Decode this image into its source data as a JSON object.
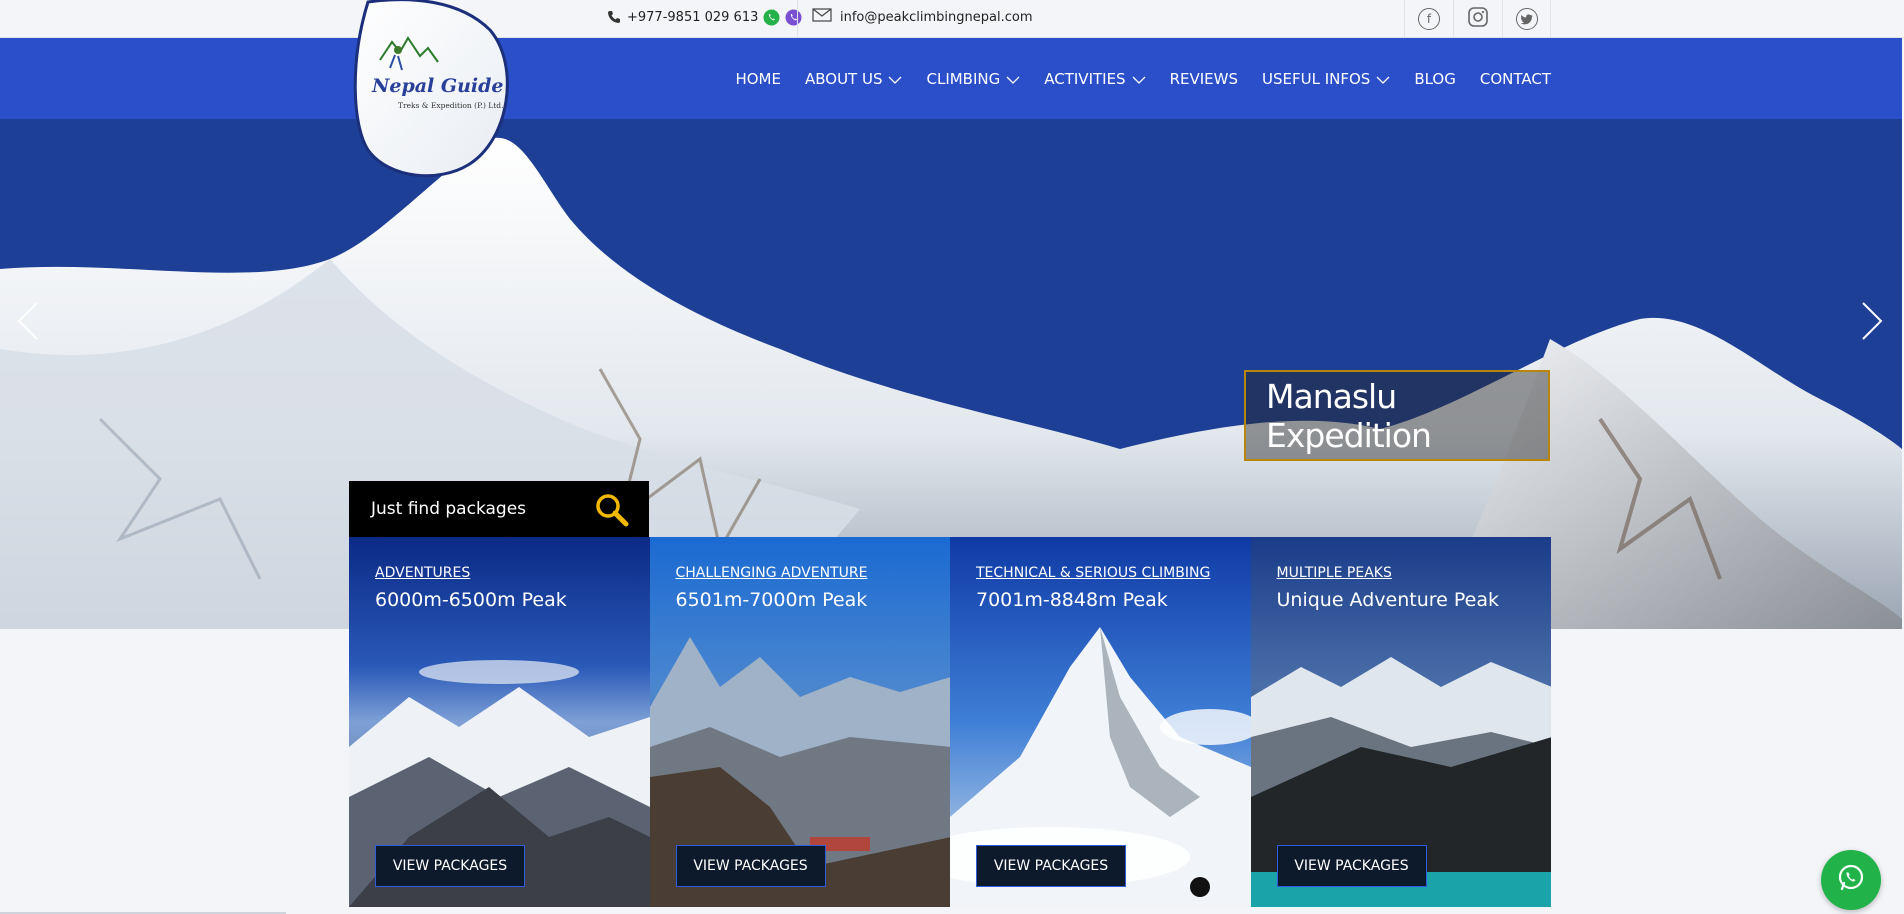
{
  "topbar": {
    "phone": "+977-9851 029 613",
    "email": "info@peakclimbingnepal.com",
    "icons": [
      "phone-icon",
      "whatsapp-icon",
      "viber-icon",
      "mail-icon"
    ],
    "social": [
      "facebook-icon",
      "instagram-icon",
      "twitter-icon"
    ]
  },
  "logo": {
    "line1": "Nepal Guide",
    "line2": "Treks & Expedition (P.) Ltd."
  },
  "nav": {
    "items": [
      {
        "label": "HOME",
        "dropdown": false
      },
      {
        "label": "ABOUT US",
        "dropdown": true
      },
      {
        "label": "CLIMBING",
        "dropdown": true
      },
      {
        "label": "ACTIVITIES",
        "dropdown": true
      },
      {
        "label": "REVIEWS",
        "dropdown": false
      },
      {
        "label": "USEFUL INFOS",
        "dropdown": true
      },
      {
        "label": "BLOG",
        "dropdown": false
      },
      {
        "label": "CONTACT",
        "dropdown": false
      }
    ]
  },
  "hero": {
    "caption": "Manaslu Expedition",
    "prev_icon": "chevron-left-icon",
    "next_icon": "chevron-right-icon"
  },
  "finder": {
    "label": "Just find packages",
    "icon": "search-icon"
  },
  "cards": [
    {
      "category": "ADVENTURES",
      "title": "6000m-6500m Peak",
      "button": "VIEW PACKAGES"
    },
    {
      "category": "CHALLENGING ADVENTURE",
      "title": "6501m-7000m Peak",
      "button": "VIEW PACKAGES"
    },
    {
      "category": "TECHNICAL & SERIOUS CLIMBING",
      "title": "7001m-8848m Peak",
      "button": "VIEW PACKAGES"
    },
    {
      "category": "MULTIPLE PEAKS",
      "title": "Unique Adventure Peak",
      "button": "VIEW PACKAGES"
    }
  ],
  "colors": {
    "nav_bg": "#2a4fc9",
    "caption_border": "#b8860b",
    "whatsapp_green": "#21b34a"
  }
}
